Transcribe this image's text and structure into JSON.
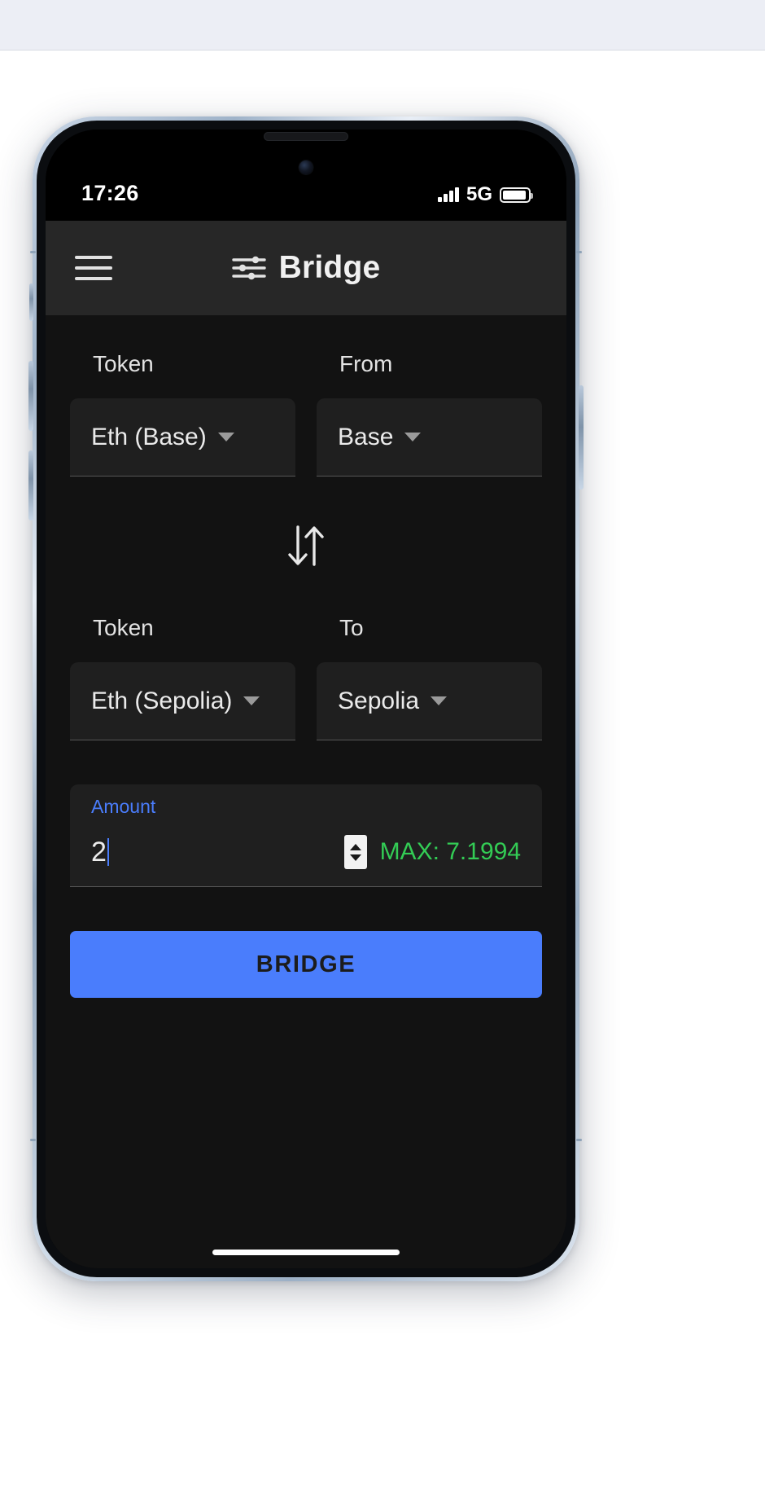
{
  "status_bar": {
    "time": "17:26",
    "network": "5G",
    "signal_icon": "cellular-signal-icon",
    "battery_icon": "battery-icon"
  },
  "app_bar": {
    "menu_icon": "hamburger-menu-icon",
    "title_icon": "sliders-icon",
    "title": "Bridge"
  },
  "source": {
    "token_label": "Token",
    "chain_label": "From",
    "token_value": "Eth (Base)",
    "chain_value": "Base"
  },
  "swap": {
    "icon": "swap-vertical-icon"
  },
  "destination": {
    "token_label": "Token",
    "chain_label": "To",
    "token_value": "Eth (Sepolia)",
    "chain_value": "Sepolia"
  },
  "amount": {
    "label": "Amount",
    "value": "2",
    "placeholder": "0",
    "stepper_icon": "number-stepper-icon",
    "max_text": "MAX: 7.1994"
  },
  "action": {
    "bridge_label": "BRIDGE"
  },
  "colors": {
    "accent": "#4a7dfc",
    "max_green": "#33cc55",
    "app_bg": "#121212",
    "appbar_bg": "#272727",
    "field_bg": "#1f1f1f"
  }
}
